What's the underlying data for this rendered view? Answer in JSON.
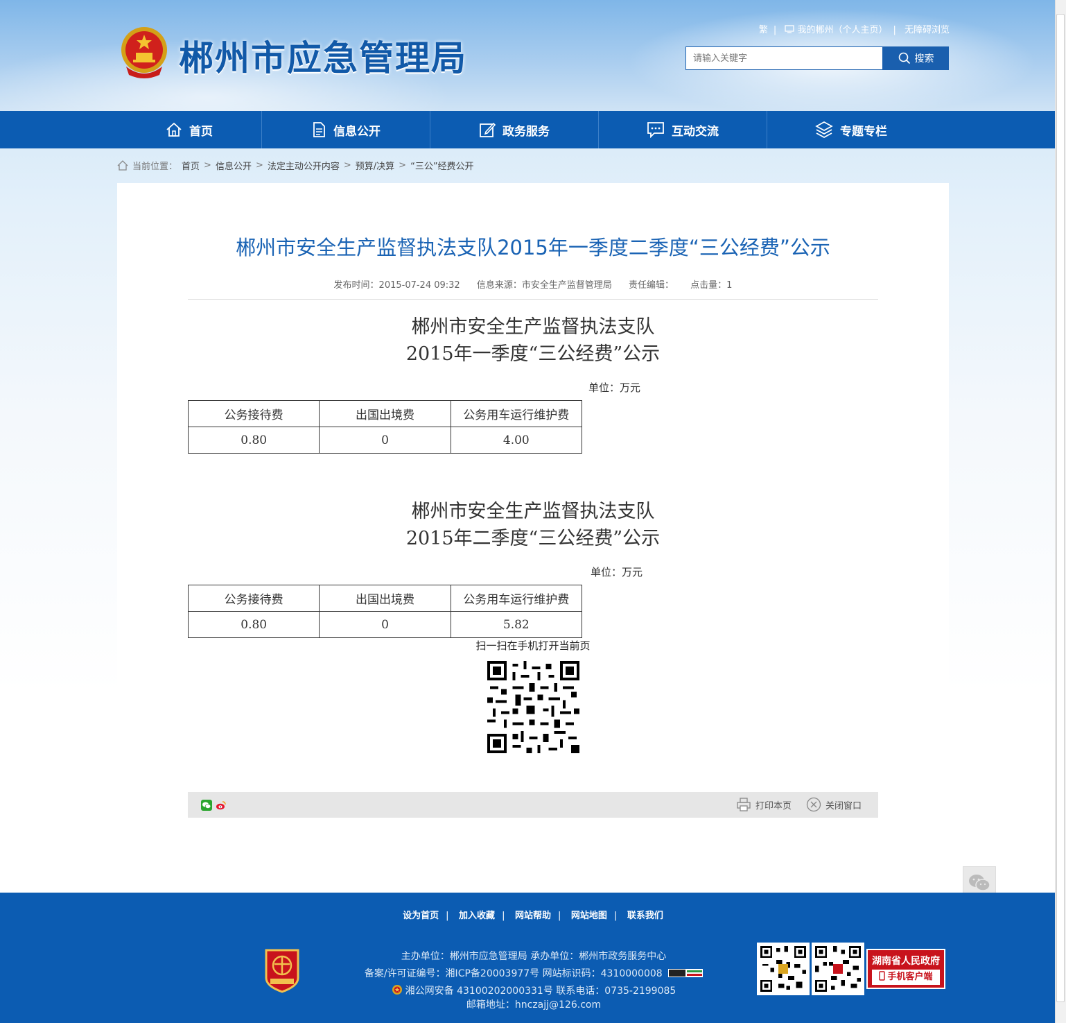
{
  "header": {
    "site_title": "郴州市应急管理局",
    "links": {
      "traditional": "繁",
      "my_chenzhou": "我的郴州（个人主页）",
      "accessible": "无障碍浏览"
    },
    "search": {
      "placeholder": "请输入关键字",
      "button_label": "搜索"
    }
  },
  "nav": {
    "items": [
      {
        "label": "首页",
        "icon": "home-icon"
      },
      {
        "label": "信息公开",
        "icon": "document-icon"
      },
      {
        "label": "政务服务",
        "icon": "edit-icon"
      },
      {
        "label": "互动交流",
        "icon": "chat-icon"
      },
      {
        "label": "专题专栏",
        "icon": "layers-icon"
      }
    ]
  },
  "breadcrumb": {
    "prefix": "当前位置：",
    "items": [
      "首页",
      "信息公开",
      "法定主动公开内容",
      "预算/决算",
      "“三公”经费公开"
    ],
    "separator": ">"
  },
  "article": {
    "title": "郴州市安全生产监督执法支队2015年一季度二季度“三公经费”公示",
    "meta": {
      "publish_time": "发布时间：2015-07-24 09:32",
      "source": "信息来源：市安全生产监督管理局",
      "editor": "责任编辑：",
      "hits": "点击量：1"
    },
    "sections": [
      {
        "title_line1": "郴州市安全生产监督执法支队",
        "title_line2": "2015年一季度“三公经费”公示",
        "unit": "单位：万元",
        "headers": [
          "公务接待费",
          "出国出境费",
          "公务用车运行维护费"
        ],
        "values": [
          "0.80",
          "0",
          "4.00"
        ]
      },
      {
        "title_line1": "郴州市安全生产监督执法支队",
        "title_line2": "2015年二季度“三公经费”公示",
        "unit": "单位：万元",
        "headers": [
          "公务接待费",
          "出国出境费",
          "公务用车运行维护费"
        ],
        "values": [
          "0.80",
          "0",
          "5.82"
        ]
      }
    ],
    "qr_caption": "扫一扫在手机打开当前页",
    "actions": {
      "print": "打印本页",
      "close": "关闭窗口"
    }
  },
  "footer": {
    "links": [
      "设为首页",
      "加入收藏",
      "网站帮助",
      "网站地图",
      "联系我们"
    ],
    "line1": "主办单位：郴州市应急管理局   承办单位：郴州市政务服务中心",
    "line2": "备案/许可证编号：湘ICP备20003977号   网站标识码：4310000008",
    "line3": "湘公网安备 43100202000331号   联系电话：0735-2199085",
    "line4": "邮箱地址：hnczajj@126.com",
    "gov_app_line1": "湖南省人民政府",
    "gov_app_line2": "手机客户端"
  },
  "colors": {
    "brand_blue": "#0c5cb2",
    "title_blue": "#1a63b4",
    "gov_red": "#c8131c"
  }
}
